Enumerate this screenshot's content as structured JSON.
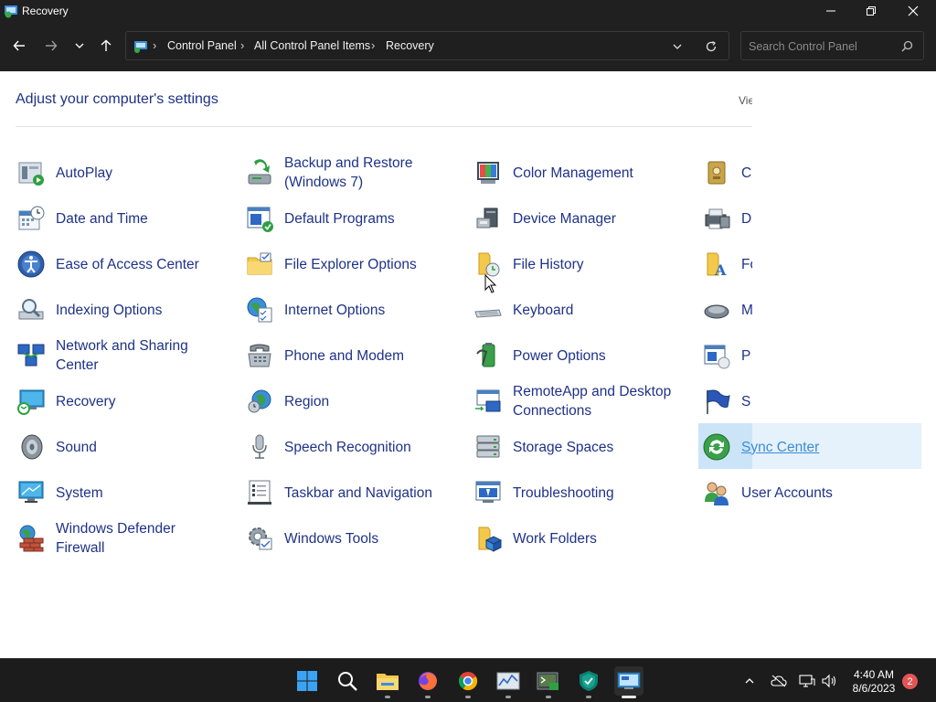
{
  "window": {
    "title": "Recovery",
    "breadcrumb": [
      "Control Panel",
      "All Control Panel Items",
      "Recovery"
    ],
    "search_placeholder": "Search Control Panel"
  },
  "content": {
    "heading": "Adjust your computer's settings",
    "view_by_label": "Vie",
    "items": [
      {
        "label": "AutoPlay",
        "icon": "autoplay-icon"
      },
      {
        "label": "Backup and Restore (Windows 7)",
        "icon": "backup-restore-icon"
      },
      {
        "label": "Color Management",
        "icon": "color-management-icon"
      },
      {
        "label": "C",
        "icon": "credential-manager-icon"
      },
      {
        "label": "Date and Time",
        "icon": "date-time-icon"
      },
      {
        "label": "Default Programs",
        "icon": "default-programs-icon"
      },
      {
        "label": "Device Manager",
        "icon": "device-manager-icon"
      },
      {
        "label": "D",
        "icon": "devices-printers-icon"
      },
      {
        "label": "Ease of Access Center",
        "icon": "ease-of-access-icon"
      },
      {
        "label": "File Explorer Options",
        "icon": "file-explorer-options-icon"
      },
      {
        "label": "File History",
        "icon": "file-history-icon"
      },
      {
        "label": "Fo",
        "icon": "fonts-icon"
      },
      {
        "label": "Indexing Options",
        "icon": "indexing-options-icon"
      },
      {
        "label": "Internet Options",
        "icon": "internet-options-icon"
      },
      {
        "label": "Keyboard",
        "icon": "keyboard-icon"
      },
      {
        "label": "M",
        "icon": "mouse-icon"
      },
      {
        "label": "Network and Sharing Center",
        "icon": "network-sharing-icon"
      },
      {
        "label": "Phone and Modem",
        "icon": "phone-modem-icon"
      },
      {
        "label": "Power Options",
        "icon": "power-options-icon"
      },
      {
        "label": "P",
        "icon": "programs-features-icon"
      },
      {
        "label": "Recovery",
        "icon": "recovery-icon"
      },
      {
        "label": "Region",
        "icon": "region-icon"
      },
      {
        "label": "RemoteApp and Desktop Connections",
        "icon": "remoteapp-icon"
      },
      {
        "label": "S",
        "icon": "security-maintenance-icon"
      },
      {
        "label": "Sound",
        "icon": "sound-icon"
      },
      {
        "label": "Speech Recognition",
        "icon": "speech-recognition-icon"
      },
      {
        "label": "Storage Spaces",
        "icon": "storage-spaces-icon"
      },
      {
        "label": "Sync Center",
        "icon": "sync-center-icon"
      },
      {
        "label": "System",
        "icon": "system-icon"
      },
      {
        "label": "Taskbar and Navigation",
        "icon": "taskbar-navigation-icon"
      },
      {
        "label": "Troubleshooting",
        "icon": "troubleshooting-icon"
      },
      {
        "label": "User Accounts",
        "icon": "user-accounts-icon"
      },
      {
        "label": "Windows Defender Firewall",
        "icon": "firewall-icon"
      },
      {
        "label": "Windows Tools",
        "icon": "windows-tools-icon"
      },
      {
        "label": "Work Folders",
        "icon": "work-folders-icon"
      }
    ]
  },
  "taskbar": {
    "apps": [
      "start-icon",
      "search-icon",
      "file-explorer-icon",
      "firefox-icon",
      "chrome-icon",
      "resource-monitor-icon",
      "terminal-icon",
      "defender-icon",
      "control-panel-icon"
    ],
    "time": "4:40 AM",
    "date": "8/6/2023",
    "notification_count": "2"
  },
  "colors": {
    "link": "#1e3287",
    "hover": "#e5f1fb",
    "chrome_dark": "#202020"
  }
}
